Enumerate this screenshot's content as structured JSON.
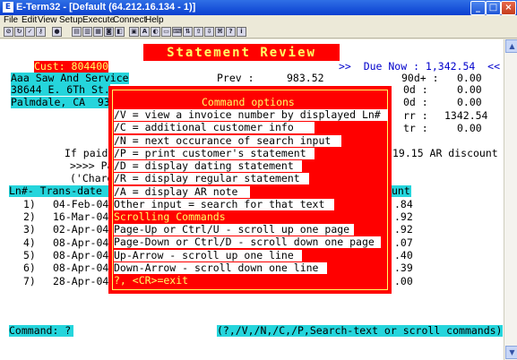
{
  "window": {
    "title": "E-Term32 - [Default (64.212.16.134 - 1)]"
  },
  "menu": [
    "File",
    "Edit",
    "View",
    "Setup",
    "Execute",
    "Connect",
    "Help"
  ],
  "screen": {
    "banner": "Statement Review",
    "cust": "Cust: 804400",
    "due_now": ">>  Due Now : 1,342.54  <<",
    "address": [
      "Aaa Saw And Service",
      "38644 E. 6Th St.",
      "Palmdale, CA  93"
    ],
    "prev_label": "Prev :",
    "prev_value": "983.52",
    "aging": [
      {
        "label": "90d+ :",
        "value": "0.00"
      },
      {
        "label": "0d :",
        "value": "0.00"
      },
      {
        "label": "0d :",
        "value": "0.00"
      },
      {
        "label": "rr :",
        "value": "1342.54"
      },
      {
        "label": "tr :",
        "value": "0.00"
      }
    ],
    "if_paid": "If paid",
    "discount": "19.15 AR discount",
    "pa": ">>>> Pa",
    "charg": "('Charg",
    "headers": {
      "ln": "Ln#-",
      "trans": "Trans-date",
      "amount": "unt"
    },
    "rows": [
      {
        "ln": "1)",
        "date": "04-Feb-04",
        "amt": ".84"
      },
      {
        "ln": "2)",
        "date": "16-Mar-04",
        "amt": ".92"
      },
      {
        "ln": "3)",
        "date": "02-Apr-04",
        "amt": ".92"
      },
      {
        "ln": "4)",
        "date": "08-Apr-04",
        "amt": ".07"
      },
      {
        "ln": "5)",
        "date": "08-Apr-04",
        "amt": ".40"
      },
      {
        "ln": "6)",
        "date": "08-Apr-04",
        "amt": ".39"
      },
      {
        "ln": "7)",
        "date": "28-Apr-04",
        "amt": ".00"
      }
    ],
    "command_prompt": "Command: ?",
    "command_hint": "(?,/V,/N,/C,/P,Search-text or scroll commands)"
  },
  "popup": {
    "title": "Command options",
    "options": [
      "/V = view a invoice number by displayed Ln#",
      "/C = additional customer info",
      "/N = next occurance of search input",
      "/P = print customer's statement",
      "/D = display dating statement",
      "/R = display regular statement",
      "/A = display AR note",
      "Other input = search for that text"
    ],
    "scroll_title": "Scrolling Commands",
    "scroll_options": [
      "Page-Up or Ctrl/U - scroll up one page",
      "Page-Down or Ctrl/D - scroll down one page",
      "Up-Arrow - scroll up one line",
      "Down-Arrow - scroll down one line"
    ],
    "footer": "?, <CR>=exit"
  }
}
